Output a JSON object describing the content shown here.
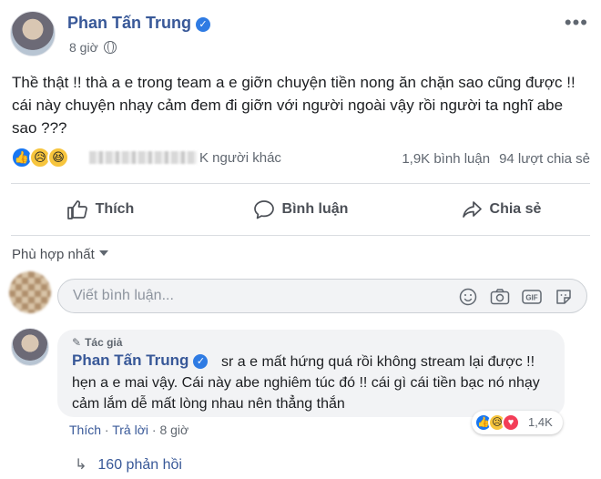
{
  "post": {
    "author": "Phan Tấn Trung",
    "time": "8 giờ",
    "more": "•••",
    "text": "Thề thật !! thà a e trong team a e giỡn chuyện tiền nong ăn chặn sao cũng được !! cái này chuyện nhạy cảm đem đi giỡn với người ngoài vậy rồi người ta nghĩ abe sao ???"
  },
  "reactions": {
    "names_suffix": "K người khác",
    "comments": "1,9K bình luận",
    "shares": "94 lượt chia sẻ"
  },
  "actions": {
    "like": "Thích",
    "comment": "Bình luận",
    "share": "Chia sẻ"
  },
  "sort": {
    "label": "Phù hợp nhất"
  },
  "composer": {
    "placeholder": "Viết bình luận...",
    "gif": "GIF"
  },
  "comment": {
    "author_tag": "Tác giả",
    "author": "Phan Tấn Trung",
    "text": "sr a e mất hứng quá rồi không stream lại được !! hẹn a e mai vậy. Cái này abe nghiêm túc đó !! cái gì cái tiền bạc nó nhạy cảm lắm dễ mất lòng nhau nên thẳng thắn",
    "like": "Thích",
    "reply": "Trả lời",
    "time": "8 giờ",
    "reaction_count": "1,4K",
    "replies": "160 phản hồi"
  },
  "colors": {
    "link": "#385898",
    "meta": "#606770",
    "accent": "#1877f2"
  },
  "icons": [
    "verified-icon",
    "globe-icon",
    "more-icon",
    "like-reaction-icon",
    "sad-reaction-icon",
    "haha-reaction-icon",
    "love-reaction-icon",
    "like-icon",
    "comment-icon",
    "share-icon",
    "emoji-icon",
    "camera-icon",
    "gif-icon",
    "sticker-icon",
    "reply-arrow-icon"
  ]
}
